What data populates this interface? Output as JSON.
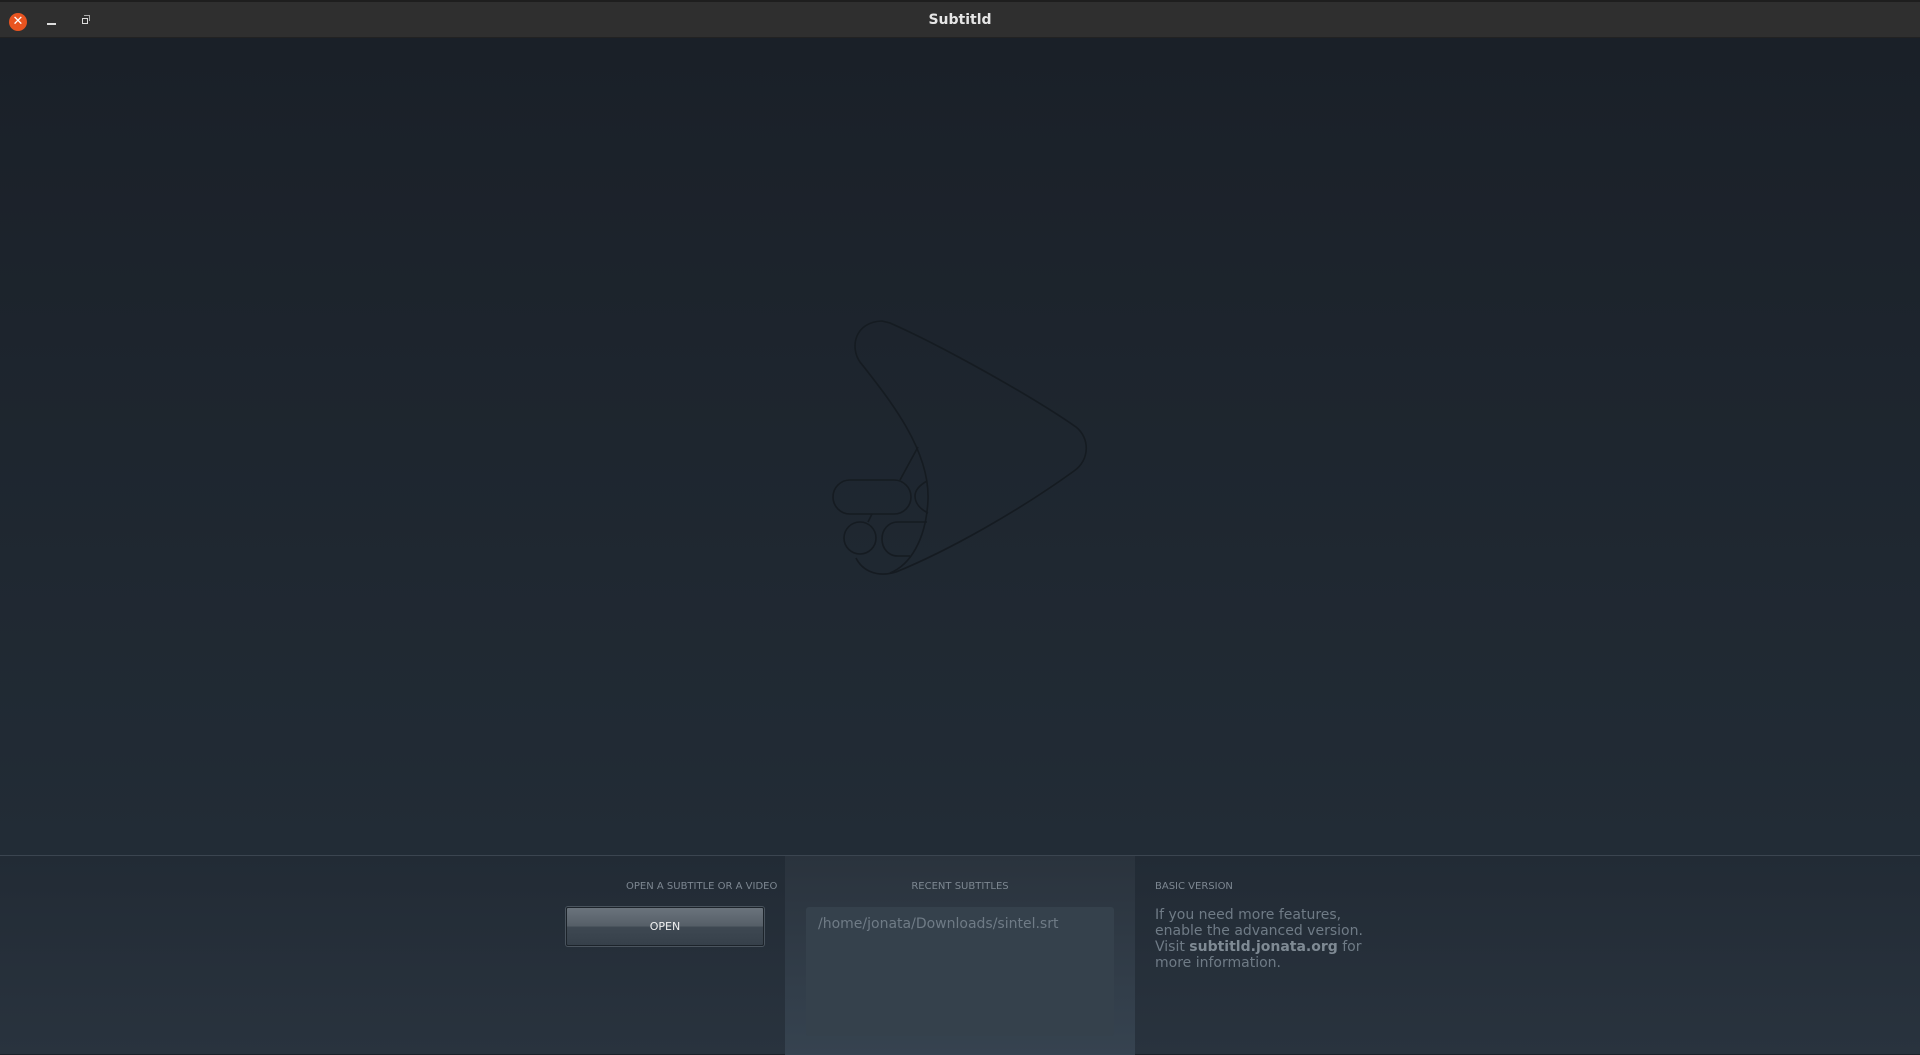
{
  "window": {
    "title": "Subtitld"
  },
  "open_section": {
    "label": "OPEN A SUBTITLE OR A VIDEO",
    "button": "OPEN"
  },
  "recent_section": {
    "label": "RECENT SUBTITLES",
    "items": [
      "/home/jonata/Downloads/sintel.srt"
    ]
  },
  "info_section": {
    "label": "BASIC VERSION",
    "text_before": "If you need more features, enable the advanced version. Visit ",
    "link": "subtitld.jonata.org",
    "text_after": " for more information."
  }
}
